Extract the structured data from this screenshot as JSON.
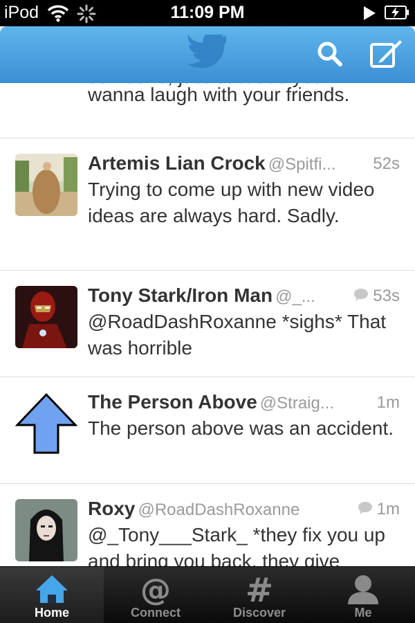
{
  "status_bar": {
    "carrier": "iPod",
    "time": "11:09 PM"
  },
  "header": {
    "logo_icon": "twitter-bird-icon",
    "search_icon": "search-icon",
    "compose_icon": "compose-icon",
    "background_color": "#4aa3df"
  },
  "feed": {
    "partial_tweet": {
      "text_line1": "someone, just because you",
      "text_line2": "wanna laugh with your friends."
    },
    "tweets": [
      {
        "name": "Artemis Lian Crock",
        "handle": "@Spitfi...",
        "time": "52s",
        "text": "Trying to come up with new video ideas are always hard. Sadly.",
        "has_reply_icon": false
      },
      {
        "name": "Tony Stark/Iron Man",
        "handle": "@_...",
        "time": "53s",
        "text": "@RoadDashRoxanne *sighs* That was horrible",
        "has_reply_icon": true
      },
      {
        "name": "The Person Above",
        "handle": "@Straig...",
        "time": "1m",
        "text": "The person above was an accident.",
        "has_reply_icon": false
      },
      {
        "name": "Roxy",
        "handle": "@RoadDashRoxanne",
        "time": "1m",
        "text": "@_Tony___Stark_ *they fix you up and bring you back. they give",
        "has_reply_icon": true
      }
    ]
  },
  "tab_bar": {
    "tabs": [
      {
        "label": "Home",
        "icon": "home-icon",
        "active": true
      },
      {
        "label": "Connect",
        "icon": "at-icon",
        "active": false
      },
      {
        "label": "Discover",
        "icon": "hashtag-icon",
        "active": false
      },
      {
        "label": "Me",
        "icon": "person-icon",
        "active": false
      }
    ]
  }
}
